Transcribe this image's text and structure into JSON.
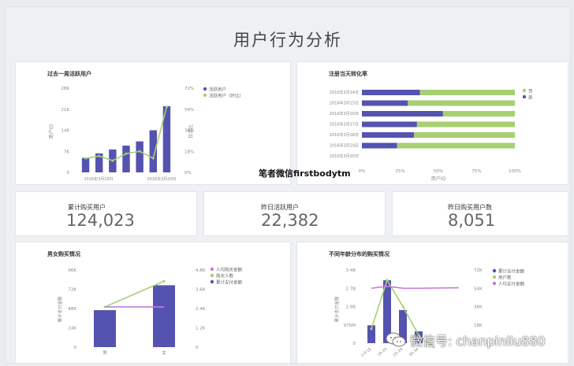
{
  "page": {
    "title": "用户行为分析"
  },
  "watermarks": {
    "middle": "笔者微信firstbodytm",
    "bottom": "微信号: chanpinliu880",
    "bottom_icon": "wechat-icon"
  },
  "kpis": [
    {
      "label": "累计购买用户",
      "value": "124,023"
    },
    {
      "label": "昨日活跃用户",
      "value": "22,382"
    },
    {
      "label": "昨日购买用户数",
      "value": "8,051"
    }
  ],
  "colors": {
    "bar": "#5553b0",
    "line": "#a6d072",
    "purple_line": "#c77ad9",
    "grid": "#d9d9d9"
  },
  "chart_data": [
    {
      "type": "bar",
      "title": "过去一周活跃用户",
      "ylabel": "用户ID",
      "y2label": "日活比",
      "ylim": [
        0,
        28000
      ],
      "y2lim": [
        0,
        72
      ],
      "yticks": [
        "28K",
        "21K",
        "14K",
        "7K",
        "0"
      ],
      "y2ticks": [
        "72%",
        "54%",
        "36%",
        "18%",
        "0%"
      ],
      "xticks": [
        "2016年3月16日",
        "2016年3月20日"
      ],
      "legend": [
        "活跃用户",
        "活跃用户（环比）"
      ],
      "legend_position": "top-right",
      "series": [
        {
          "name": "活跃用户",
          "type": "bar",
          "values": [
            4800,
            6300,
            7600,
            8900,
            10300,
            14000,
            22000
          ]
        },
        {
          "name": "活跃用户（环比）",
          "type": "line",
          "values": [
            12,
            14,
            10,
            16,
            18,
            12,
            56
          ]
        }
      ]
    },
    {
      "type": "bar",
      "orientation": "horizontal",
      "stacked": true,
      "title": "注册当天转化率",
      "xlabel": "用户ID",
      "xticks": [
        "0%",
        "25%",
        "50%",
        "75%",
        "100%"
      ],
      "categories": [
        "2016年3月14日",
        "2016年3月15日",
        "2016年3月16日",
        "2016年3月17日",
        "2016年3月18日",
        "2016年3月19日",
        "2016年3月20日"
      ],
      "legend": [
        "否",
        "是"
      ],
      "legend_position": "top-right",
      "series": [
        {
          "name": "是",
          "values": [
            38,
            30,
            53,
            36,
            34,
            23,
            0
          ]
        },
        {
          "name": "否",
          "values": [
            62,
            70,
            47,
            64,
            66,
            77,
            0
          ]
        }
      ]
    },
    {
      "type": "bar",
      "title": "男女购买情况",
      "ylabel": "累计支付金额",
      "ylim": [
        0,
        96000
      ],
      "y2lim": [
        0,
        4.8
      ],
      "yticks": [
        "96K",
        "72K",
        "48K",
        "24K",
        "0"
      ],
      "y2ticks": [
        "4.8K",
        "3.6K",
        "2.4K",
        "1.2K",
        "0"
      ],
      "categories": [
        "男",
        "女"
      ],
      "legend": [
        "人均购买金额",
        "购买人数",
        "累计支付金额"
      ],
      "legend_position": "top-right",
      "series": [
        {
          "name": "累计支付金额",
          "type": "bar",
          "values": [
            46000,
            77000
          ]
        },
        {
          "name": "购买人数",
          "type": "line",
          "values": [
            2500,
            4100
          ]
        },
        {
          "name": "人均购买金额",
          "type": "line",
          "values": [
            2500,
            2500
          ]
        }
      ]
    },
    {
      "type": "bar",
      "title": "不同年龄分布的购买情况",
      "ylabel": "累计支付金额",
      "ylim": [
        0,
        3400000
      ],
      "y2lim": [
        0,
        72000
      ],
      "yticks": [
        "3.4B",
        "2.7B",
        "1.9B",
        "970M",
        "0"
      ],
      "y2ticks": [
        "72K",
        "54K",
        "36K",
        "18K"
      ],
      "categories": [
        "小于18",
        "18-24",
        "25-29",
        "30-34"
      ],
      "legend": [
        "累计支付金额",
        "用户数",
        "人均支付金额"
      ],
      "legend_position": "top-right",
      "series": [
        {
          "name": "累计支付金额",
          "type": "bar",
          "values": [
            830000,
            2920000,
            1540000,
            550000
          ]
        },
        {
          "name": "用户数",
          "type": "line",
          "values": [
            14000,
            62000,
            36000,
            8000
          ]
        },
        {
          "name": "人均支付金额",
          "type": "line",
          "values": [
            54000,
            56000,
            54000,
            54000
          ]
        }
      ]
    }
  ]
}
